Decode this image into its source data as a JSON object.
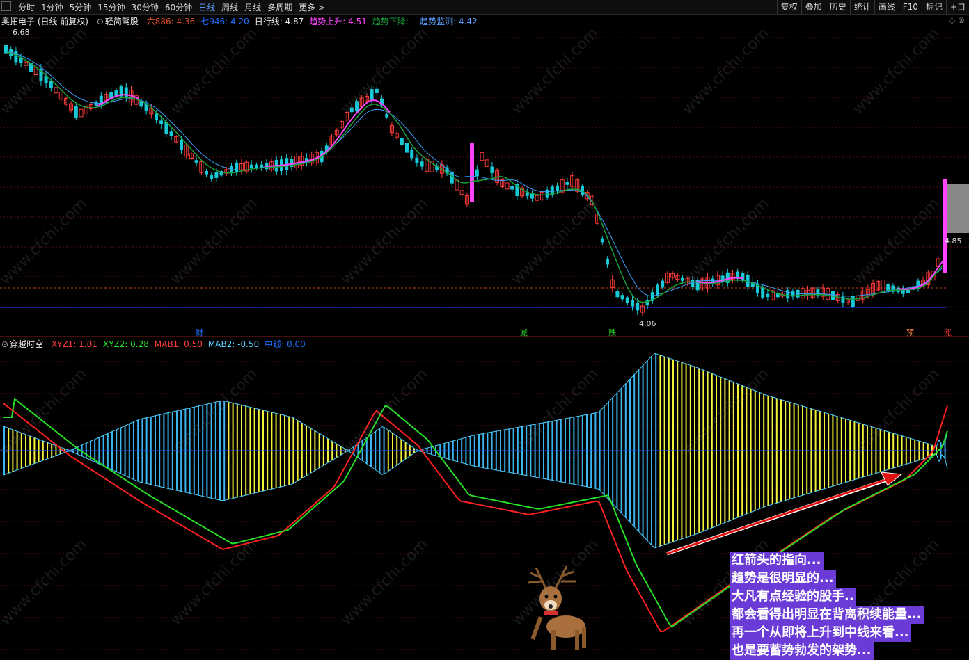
{
  "toolbar": {
    "periods": [
      "分时",
      "1分钟",
      "5分钟",
      "15分钟",
      "30分钟",
      "60分钟",
      "日线",
      "周线",
      "月线",
      "多周期",
      "更多 >"
    ],
    "active_period": "日线",
    "tools": [
      "复权",
      "叠加",
      "历史",
      "统计",
      "画线",
      "F10",
      "标记",
      "+自"
    ]
  },
  "main_panel": {
    "stock": "奥拓电子 (日线 前复权)",
    "indicator": "轻简驾股",
    "values": [
      {
        "label": "六886: 4.36",
        "color": "#e0502a"
      },
      {
        "label": "七946: 4.20",
        "color": "#1e6fff"
      },
      {
        "label": "日行线: 4.87",
        "color": "#e8e8e8"
      },
      {
        "label": "趋势上升: 4.51",
        "color": "#ff44ff"
      },
      {
        "label": "趋势下降: -",
        "color": "#19a03a"
      },
      {
        "label": "趋势监测: 4.42",
        "color": "#5aa0ff"
      }
    ],
    "high_label": "6.68",
    "low_label": "4.06",
    "current_label": "4.85",
    "markers": [
      {
        "text": "财",
        "color": "#1e6fff"
      },
      {
        "text": "减",
        "color": "#26c926"
      },
      {
        "text": "跌",
        "color": "#26c926"
      },
      {
        "text": "预",
        "color": "#ff8844"
      },
      {
        "text": "涨",
        "color": "#ff3b3b"
      }
    ]
  },
  "sub_panel": {
    "indicator": "穿越时空",
    "values": [
      {
        "label": "XYZ1: 1.01",
        "color": "#ff3b3b"
      },
      {
        "label": "XYZ2: 0.28",
        "color": "#26e026"
      },
      {
        "label": "MAB1: 0.50",
        "color": "#ff3b3b"
      },
      {
        "label": "MAB2: -0.50",
        "color": "#5ad0ff"
      },
      {
        "label": "中线: 0.00",
        "color": "#1e6fff"
      }
    ]
  },
  "annotation": [
    "红箭头的指向...",
    "趋势是很明显的...",
    "大凡有点经验的股手..",
    "都会看得出明显在背离积续能量...",
    "再一个从即将上升到中线来看...",
    "也是要蓄势勃发的架势..."
  ],
  "watermark": "www.cfchi.com",
  "window_controls": "◇ ⊗",
  "colors": {
    "up": "#ff3b3b",
    "down": "#17c9d6",
    "ma_blue": "#3a9fff",
    "ma_green": "#19a03a",
    "ma_pink": "#ff44ff",
    "bar_blue": "#3ab5f0",
    "bar_yellow": "#f2f23a"
  }
}
